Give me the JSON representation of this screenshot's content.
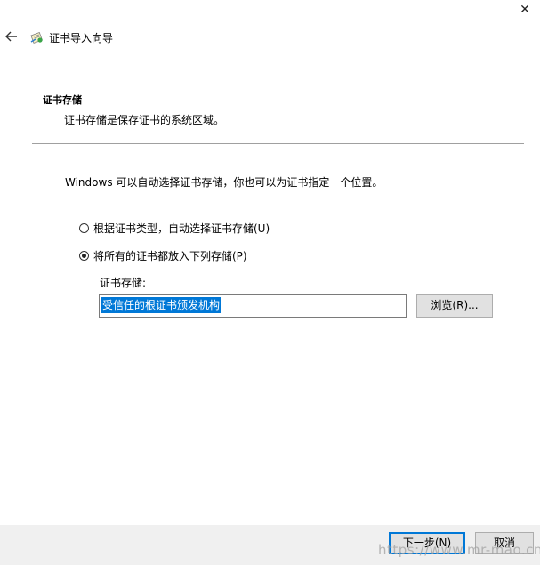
{
  "window": {
    "close_glyph": "✕",
    "title": "证书导入向导"
  },
  "section": {
    "heading": "证书存储",
    "description": "证书存储是保存证书的系统区域。"
  },
  "intro": "Windows 可以自动选择证书存储，你也可以为证书指定一个位置。",
  "options": [
    {
      "label": "根据证书类型，自动选择证书存储(U)",
      "checked": false
    },
    {
      "label": "将所有的证书都放入下列存储(P)",
      "checked": true
    }
  ],
  "store": {
    "label": "证书存储:",
    "value": "受信任的根证书颁发机构"
  },
  "buttons": {
    "browse": "浏览(R)...",
    "next": "下一步(N)",
    "cancel": "取消"
  },
  "watermark": "https://www.mr-mao.cn",
  "colors": {
    "accent": "#0078d7",
    "footer_bg": "#f0f0f0",
    "button_bg": "#e1e1e1"
  },
  "icons": {
    "back": "back-arrow-icon",
    "title": "certificate-icon",
    "close": "close-icon"
  }
}
